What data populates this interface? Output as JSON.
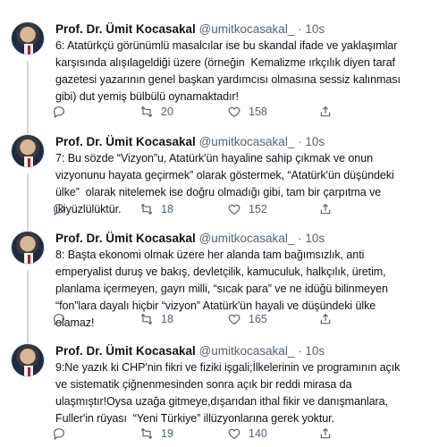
{
  "tweets": [
    {
      "name": "Prof. Dr. Ümit Kocasakal",
      "handle": "@umitkocasakal_",
      "separator": "·",
      "time": "10s",
      "text": "6: Atatürkçü görünümlü masalcılar ise bu skandal ifade ve yaklaşımlar karşısında alışılageldiği üzere (örneğin  Kemalizme ırkçılık diyen taraf gazetesi yazarının genel başkan yardımcısı olmasına sessiz kalınması gibi) dut yemiş bülbülü oynamaktadır!",
      "reply_count": "",
      "retweet_count": "20",
      "like_count": "158"
    },
    {
      "name": "Prof. Dr. Ümit Kocasakal",
      "handle": "@umitkocasakal_",
      "separator": "·",
      "time": "10s",
      "text": "7: Bu sözde “Vizyon”u, Atatürk'ün hayaline sahip çıkmak ve onun vizyonunu hayata geçirmek” olarak göstermek, “Atatürk'ün düşündeki ülke”  olarak nitelemek ise doğru olmadığı gibi, tam bir çarpıtma ve ikiyüzlülüktür.",
      "reply_count": "",
      "retweet_count": "18",
      "like_count": "152"
    },
    {
      "name": "Prof. Dr. Ümit Kocasakal",
      "handle": "@umitkocasakal_",
      "separator": "·",
      "time": "10s",
      "text": "8: Başta ekonomi olmak üzere her alanda tam bağımsızlık, anti emperyalist duruş ve bakış, devletçilik, kamuculuk, halkçılık, üretim, planlama içermeyen, gayrı milli, “sıcak para” ve ne idüğü bilinmeyen “fon”lara dayalı hiçbir “vizyon” Atatürk'ün hayali ve düşündeki ülke olamaz!",
      "reply_count": "",
      "retweet_count": "18",
      "like_count": "165"
    },
    {
      "name": "Prof. Dr. Ümit Kocasakal",
      "handle": "@umitkocasakal_",
      "separator": "·",
      "time": "10s",
      "text": "9:Ne yazık ki CHP'nin fikri ve fiziki işgali;İlkelerinin ve programının açık ve sistematik çiğnenmesinden sonra açık bir reddi mirasa da ulaşmıştır!Oysa uzağa gitmeye,dışarıdan ithal fikir ve danışmanlara, Fuller'in rüyası  “Yeni Türkiye” illüzyonlarına gerek yoktur.",
      "reply_count": "",
      "retweet_count": "19",
      "like_count": "140"
    }
  ],
  "icons": {
    "reply": "reply-icon",
    "retweet": "retweet-icon",
    "like": "heart-icon",
    "share": "share-icon"
  },
  "colors": {
    "text": "#0f1419",
    "muted": "#536471",
    "thread_line": "#cfd9de"
  }
}
